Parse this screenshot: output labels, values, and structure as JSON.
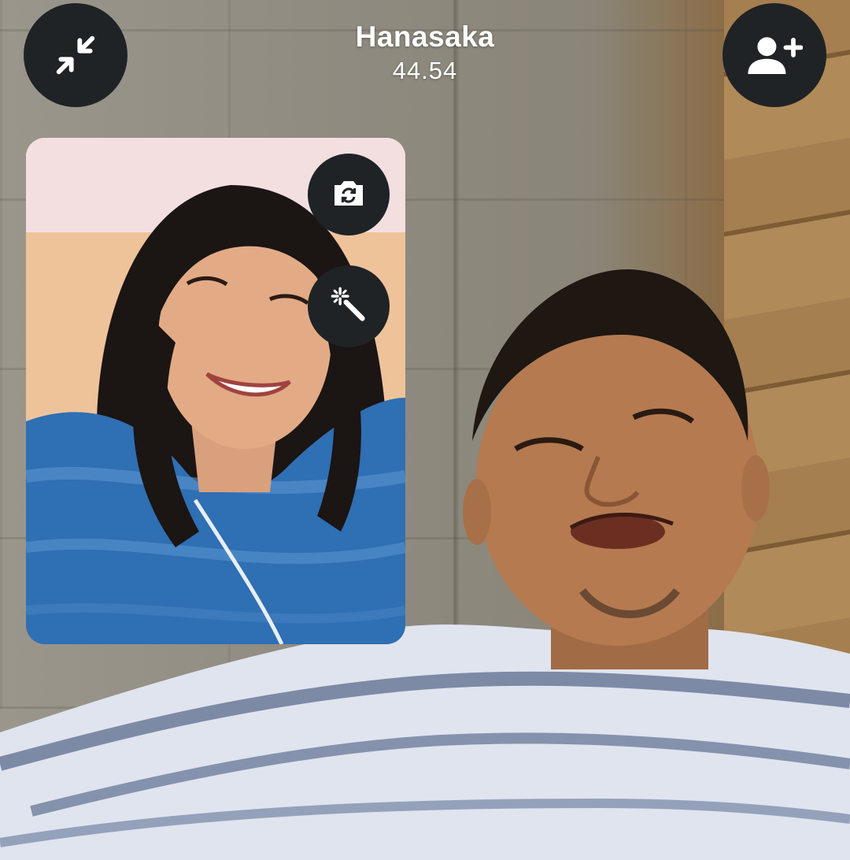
{
  "call": {
    "caller_name": "Hanasaka",
    "timer": "44.54"
  },
  "icons": {
    "minimize": "collapse-arrows-icon",
    "add_participant": "add-person-icon",
    "flip_camera": "flip-camera-icon",
    "effects": "magic-wand-icon"
  },
  "colors": {
    "button_bg": "#1f2326",
    "icon": "#ffffff",
    "text": "#ffffff"
  }
}
